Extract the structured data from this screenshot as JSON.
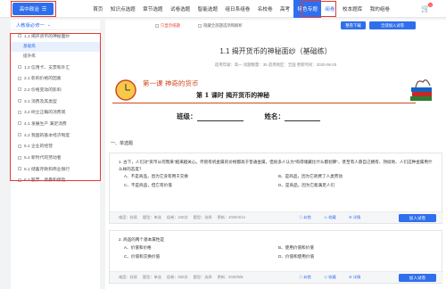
{
  "nav": {
    "subject_button": "高中政治",
    "items": [
      "首页",
      "知识点选题",
      "章节选题",
      "试卷选题",
      "智能选题",
      "组日系组卷",
      "名校卷",
      "高考",
      "特色专题",
      "阅卷",
      "校本题库",
      "我的组卷"
    ],
    "active_index": 8,
    "special_index": 9,
    "cart_count": "0"
  },
  "sidebar": {
    "version": "人教版必修一",
    "items": [
      {
        "label": "1.1 揭开货币的神秘面纱",
        "subs": [
          "基础练",
          "提升练"
        ]
      },
      {
        "label": "1.2 信用卡、支票和外汇"
      },
      {
        "label": "2.1 影响价格的因素"
      },
      {
        "label": "2.2 价格变动的影响"
      },
      {
        "label": "3.1 消费及其类型"
      },
      {
        "label": "3.2 树立正确的消费观"
      },
      {
        "label": "4.1 发展生产 满足消费"
      },
      {
        "label": "4.2 我国的基本经济制度"
      },
      {
        "label": "5.1 企业的经营"
      },
      {
        "label": "5.2 新时代的劳动者"
      },
      {
        "label": "6.1 储蓄存款和商业银行"
      },
      {
        "label": "6.2 股票、债券和保险"
      }
    ]
  },
  "toolbar": {
    "only_wrong": "只显示纸题",
    "hide_choice": "隐藏全部题选项和解析",
    "download": "整卷下载",
    "add_all": "全部加入试卷"
  },
  "paper": {
    "title": "1.1 揭开货币的神秘面纱（基础练）",
    "meta": "适用年级：高一 试题数量：35 适用地区：全国 更新时间：2020-08-25",
    "lesson_title": "第一课   神奇的货币",
    "lesson_subtitle": "第 1 课时    揭开货币的神秘",
    "class_label": "班级：",
    "name_label": "姓名：",
    "section": "一、单选题"
  },
  "questions": [
    {
      "text": "1. 古下，人们对\"货币从何而来\"越来越关心。尽管有机金属的价格都高于普通金属，但很多人认为\"购得储藏比什么都划算\"，甚至有人愿自己拥有、持续地、人们这种金属用什么样的态度？",
      "options": [
        "A、不是商品，因为它没有用于交换",
        "B、是商品，因为它耗费了人类劳动",
        "C、不是商品，但它有价值",
        "D、是商品，因为它能满足人们"
      ],
      "type": "题型：单选",
      "difficulty": "难度：较易",
      "count": "组卷：240次",
      "tag": "题型：选择",
      "date": "更新：2020/4/14",
      "actions": [
        "纠错",
        "收藏",
        "详情"
      ],
      "join": "加入试卷"
    },
    {
      "text": "2. 商品的两个基本属性是",
      "options": [
        "A、价值和价格",
        "B、使用价值和价值",
        "C、价值和交换价值",
        "D、价值和使用价值"
      ],
      "type": "题型：单选",
      "difficulty": "难度：较易",
      "count": "组卷：830次",
      "tag": "题型：选择",
      "date": "更新：2020/6/8",
      "actions": [
        "纠错",
        "收藏",
        "详情"
      ],
      "join": "加入试卷"
    }
  ],
  "colors": {
    "accent": "#2f6fed",
    "highlight": "#e53935"
  }
}
